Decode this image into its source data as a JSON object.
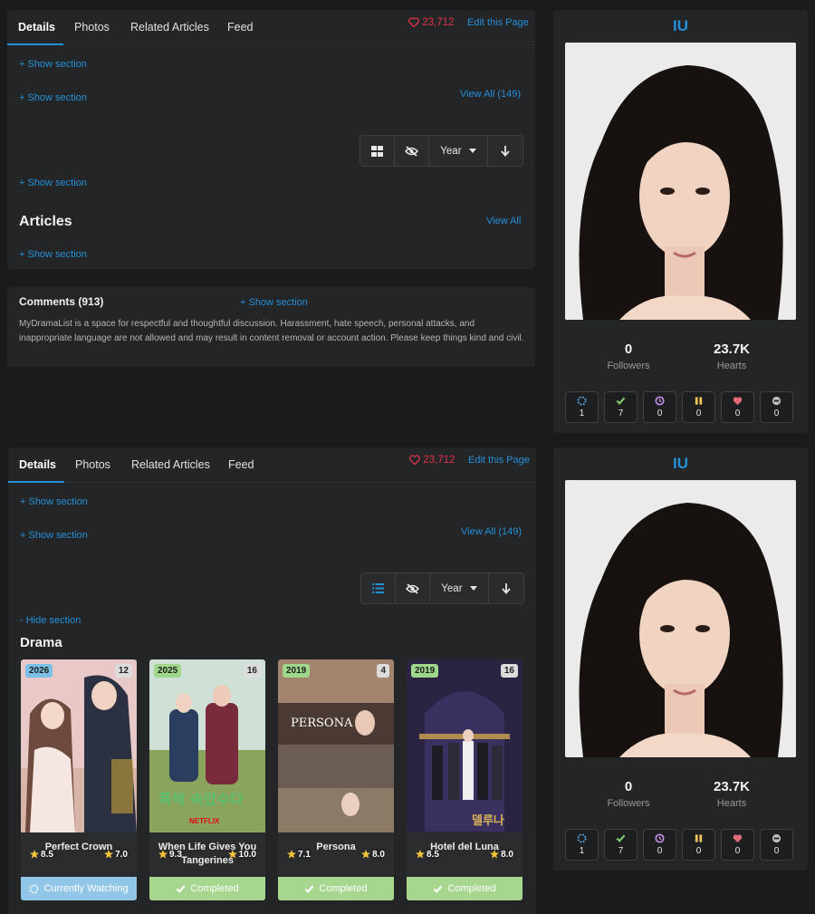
{
  "tabs": [
    "Details",
    "Photos",
    "Related Articles",
    "Feed"
  ],
  "hearts_count": "23,712",
  "edit_page": "Edit this Page",
  "show_section": "+ Show section",
  "hide_section": "- Hide section",
  "view_all_149": "View All (149)",
  "view_all": "View All",
  "sort": {
    "year_label": "Year"
  },
  "articles_title": "Articles",
  "comments": {
    "title": "Comments (913)",
    "notice": "MyDramaList is a space for respectful and thoughtful discussion. Harassment, hate speech, personal attacks, and inappropriate language are not allowed and may result in content removal or account action. Please keep things kind and civil."
  },
  "drama_title": "Drama",
  "sidebar": {
    "name": "IU",
    "followers_value": "0",
    "followers_label": "Followers",
    "hearts_value": "23.7K",
    "hearts_label": "Hearts",
    "statuses": [
      {
        "icon": "watching-icon",
        "count": "1",
        "color": "#5aa9e6"
      },
      {
        "icon": "completed-icon",
        "count": "7",
        "color": "#7ec96a"
      },
      {
        "icon": "plan-to-watch-icon",
        "count": "0",
        "color": "#c28fe8"
      },
      {
        "icon": "on-hold-icon",
        "count": "0",
        "color": "#f2c45a"
      },
      {
        "icon": "favorite-icon",
        "count": "0",
        "color": "#e36a7a"
      },
      {
        "icon": "dropped-icon",
        "count": "0",
        "color": "#bdbdbd"
      }
    ]
  },
  "dramas": [
    {
      "title": "Perfect Crown",
      "year": "2026",
      "episodes": "12",
      "rating_left": "8.5",
      "rating_right": "7.0",
      "status": "Currently Watching",
      "year_color": "#7cc0e8",
      "status_color": "#92c6e8"
    },
    {
      "title": "When Life Gives You Tangerines",
      "year": "2025",
      "episodes": "16",
      "rating_left": "9.3",
      "rating_right": "10.0",
      "network": "NETFLIX",
      "status": "Completed",
      "year_color": "#9fd88a",
      "status_color": "#a7d68f"
    },
    {
      "title": "Persona",
      "year": "2019",
      "episodes": "4",
      "rating_left": "7.1",
      "rating_right": "8.0",
      "poster_text": "PERSONA",
      "status": "Completed",
      "year_color": "#9fd88a",
      "status_color": "#a7d68f"
    },
    {
      "title": "Hotel del Luna",
      "year": "2019",
      "episodes": "16",
      "rating_left": "8.5",
      "rating_right": "8.0",
      "status": "Completed",
      "year_color": "#9fd88a",
      "status_color": "#a7d68f"
    }
  ]
}
